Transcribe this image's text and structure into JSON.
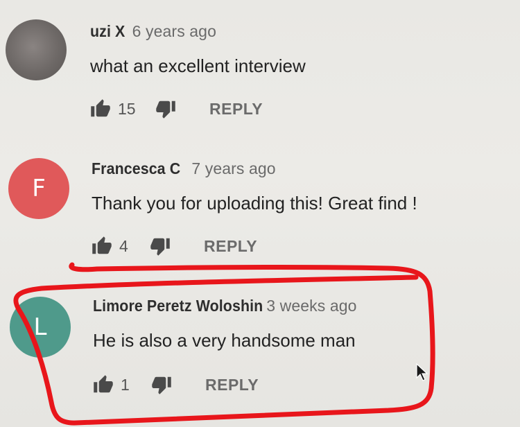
{
  "comments": [
    {
      "avatar_letter": "",
      "avatar_color": "#6f6a68",
      "author": "uzi X",
      "time": "6 years ago",
      "text": "what an excellent interview",
      "likes": "15",
      "reply_label": "REPLY"
    },
    {
      "avatar_letter": "F",
      "avatar_color": "#e0595a",
      "author": "Francesca C",
      "time": "7 years ago",
      "text": "Thank you for uploading this! Great find !",
      "likes": "4",
      "reply_label": "REPLY"
    },
    {
      "avatar_letter": "L",
      "avatar_color": "#4f9a8b",
      "author": "Limore Peretz Woloshin",
      "time": "3 weeks ago",
      "text": "He is also a very handsome man",
      "likes": "1",
      "reply_label": "REPLY"
    }
  ],
  "annotation_color": "#e8161b"
}
